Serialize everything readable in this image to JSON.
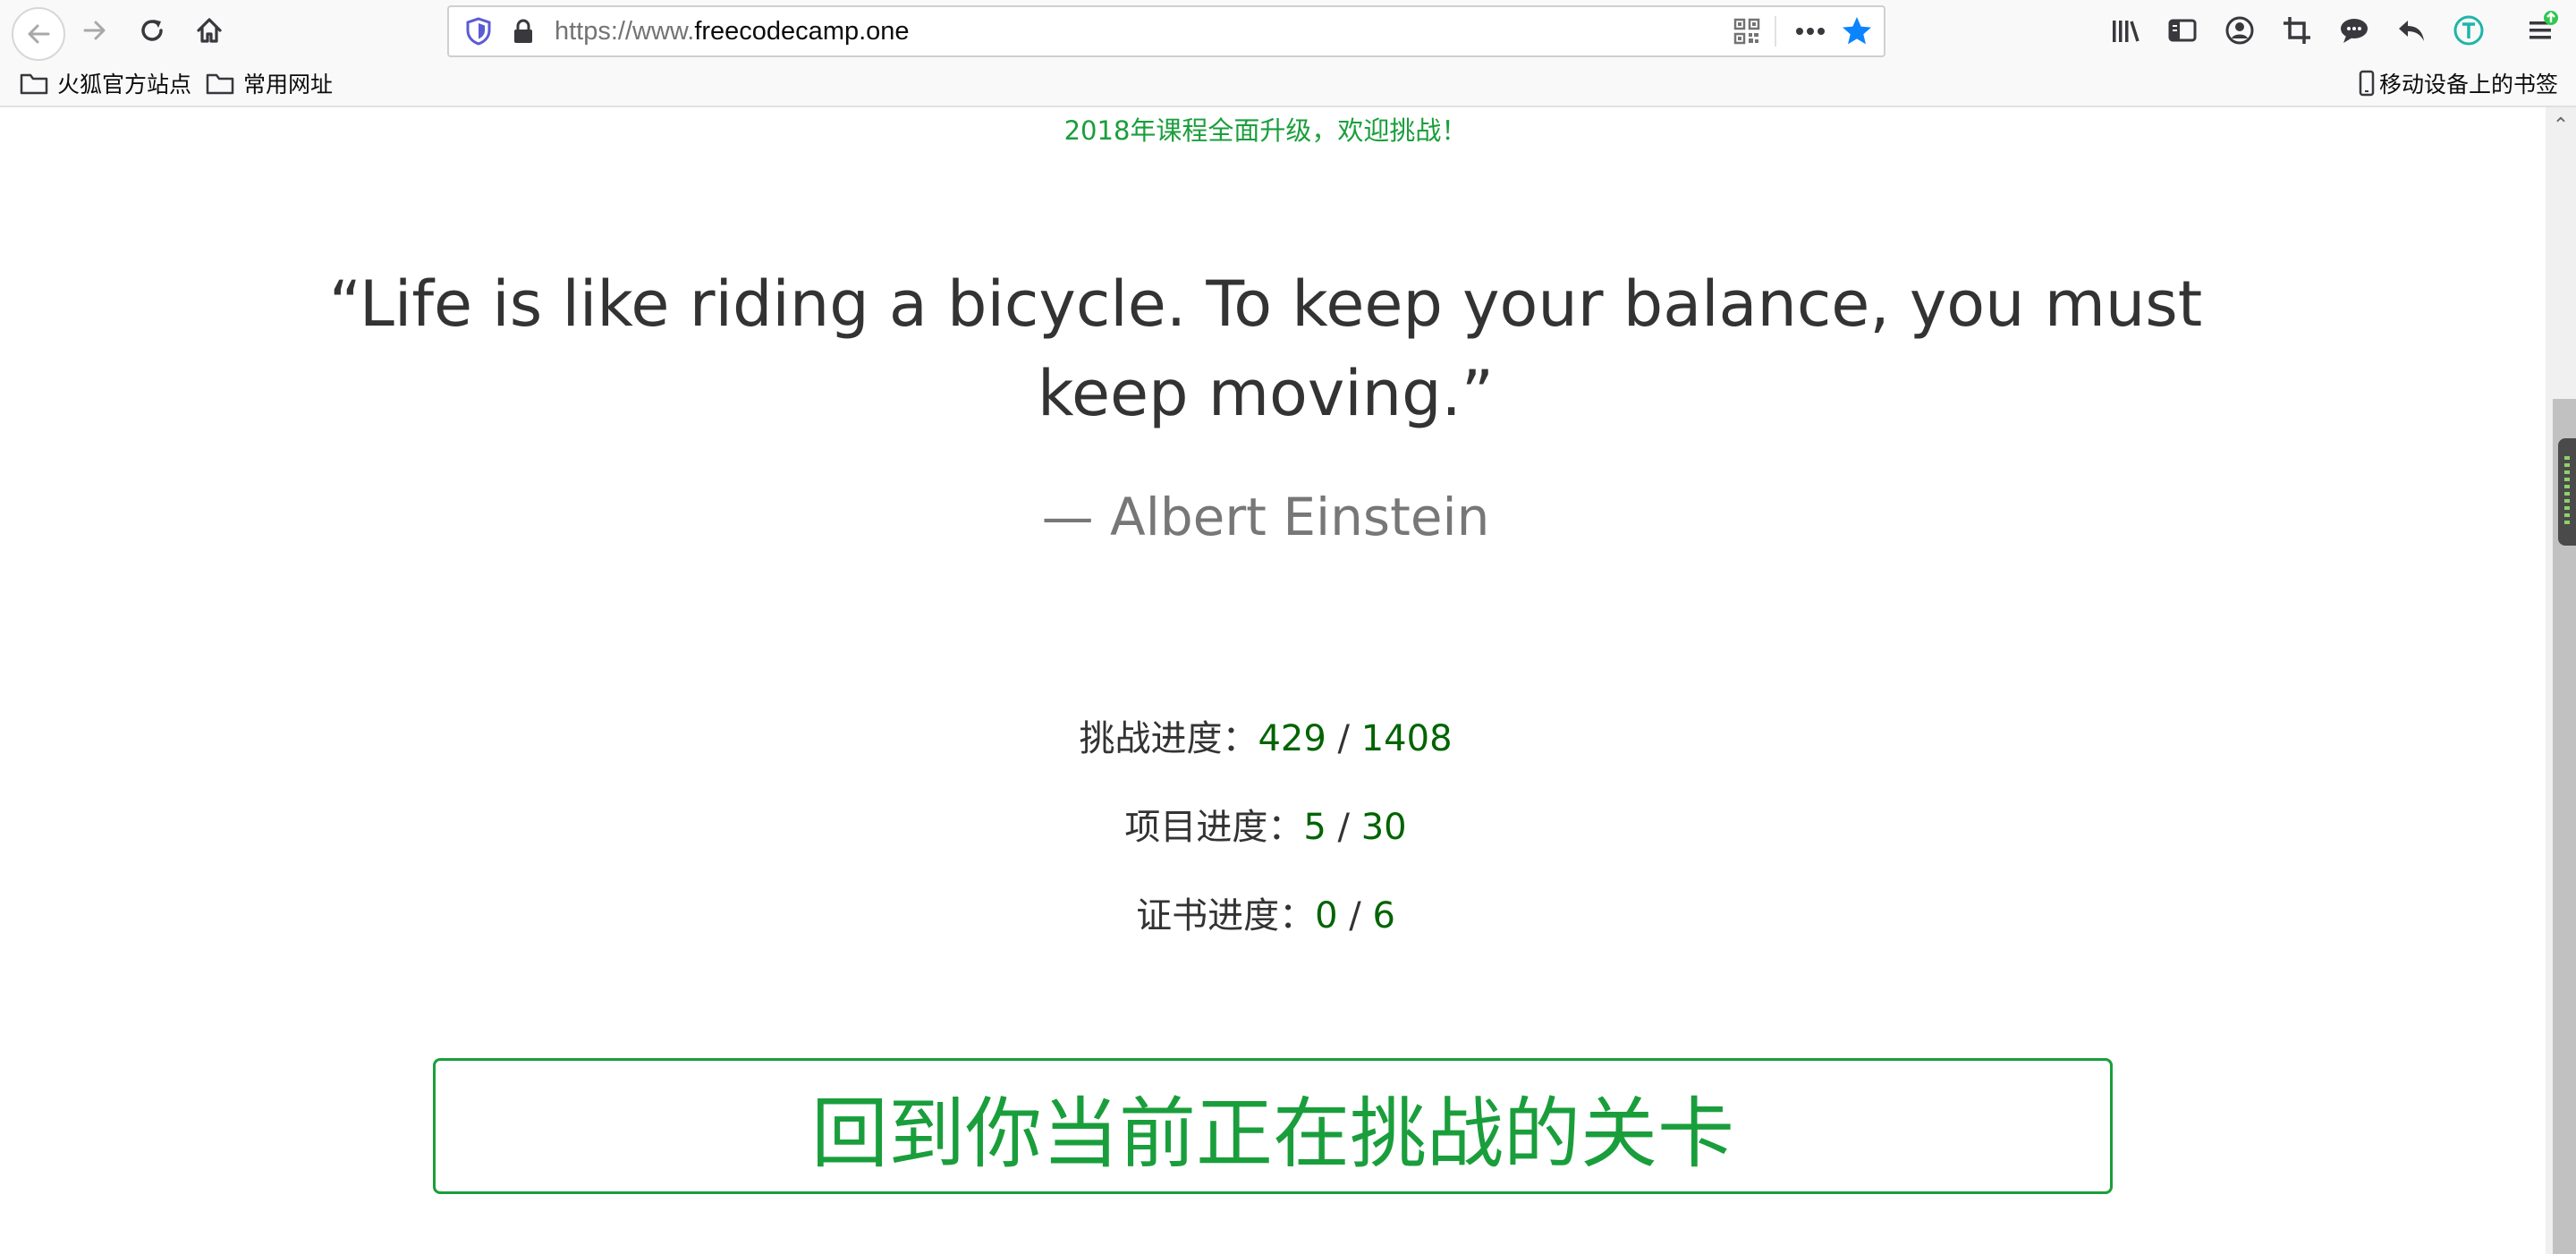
{
  "browser": {
    "url_protocol": "https://www.",
    "url_host": "freecodecamp.one",
    "bookmarks": [
      {
        "label": "火狐官方站点"
      },
      {
        "label": "常用网址"
      }
    ],
    "mobile_bookmarks": "移动设备上的书签",
    "icons": {
      "back": "back-arrow-icon",
      "forward": "forward-arrow-icon",
      "reload": "reload-icon",
      "home": "home-icon",
      "shield": "tracking-shield-icon",
      "lock": "lock-icon",
      "qr": "qr-code-icon",
      "more": "more-dots-icon",
      "bookmark_star": "star-icon",
      "library": "library-icon",
      "sidebar": "sidebar-icon",
      "account": "account-icon",
      "screenshot": "crop-icon",
      "chat": "chat-bubble-icon",
      "undo": "undo-arrow-icon",
      "translate": "t-circle-icon",
      "menu": "hamburger-menu-icon",
      "folder": "folder-icon",
      "mobile": "mobile-device-icon"
    },
    "star_color": "#0a84ff"
  },
  "page": {
    "announcement": "2018年课程全面升级，欢迎挑战！",
    "quote": "“Life is like riding a bicycle. To keep your balance, you must keep moving.”",
    "author": "— Albert Einstein",
    "progress": [
      {
        "label": "挑战进度：",
        "done": "429",
        "separator": " / ",
        "total": "1408"
      },
      {
        "label": "项目进度：",
        "done": "5",
        "separator": " / ",
        "total": "30"
      },
      {
        "label": "证书进度：",
        "done": "0",
        "separator": " / ",
        "total": "6"
      }
    ],
    "challenge_button": "回到你当前正在挑战的关卡",
    "accent_color": "#1a9e3c",
    "number_color": "#006400"
  }
}
